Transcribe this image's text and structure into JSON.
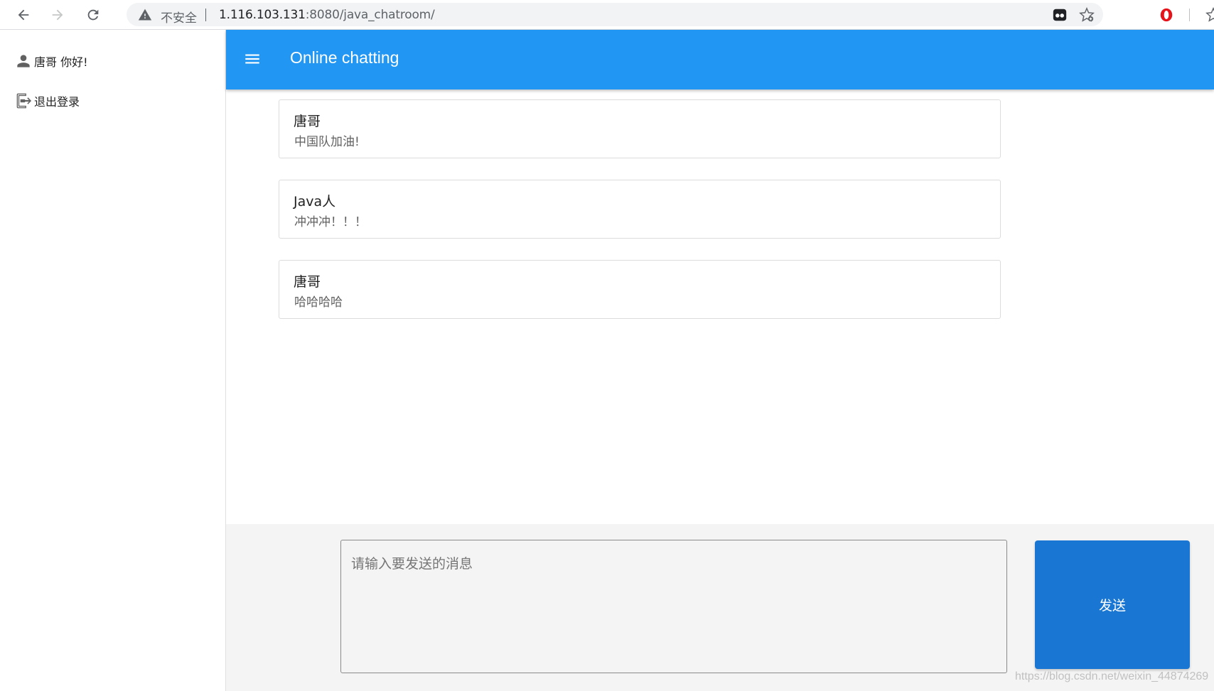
{
  "browser": {
    "insecure_label": "不安全",
    "url_host": "1.116.103.131",
    "url_rest": ":8080/java_chatroom/",
    "icons": [
      "back-arrow-icon",
      "forward-arrow-icon",
      "reload-icon",
      "warning-icon",
      "bookmark-star-icon",
      "extension-icon",
      "opera-icon"
    ]
  },
  "sidebar": {
    "greeting": "唐哥 你好!",
    "logout_label": "退出登录"
  },
  "appbar": {
    "title": "Online chatting",
    "color": "#2196f3"
  },
  "messages": [
    {
      "sender": "唐哥",
      "text": "中国队加油!"
    },
    {
      "sender": "Java人",
      "text": "冲冲冲！！！"
    },
    {
      "sender": "唐哥",
      "text": "哈哈哈哈"
    }
  ],
  "composer": {
    "placeholder": "请输入要发送的消息",
    "value": "",
    "send_label": "发送",
    "send_color": "#1976d2"
  },
  "watermark": "https://blog.csdn.net/weixin_44874269"
}
